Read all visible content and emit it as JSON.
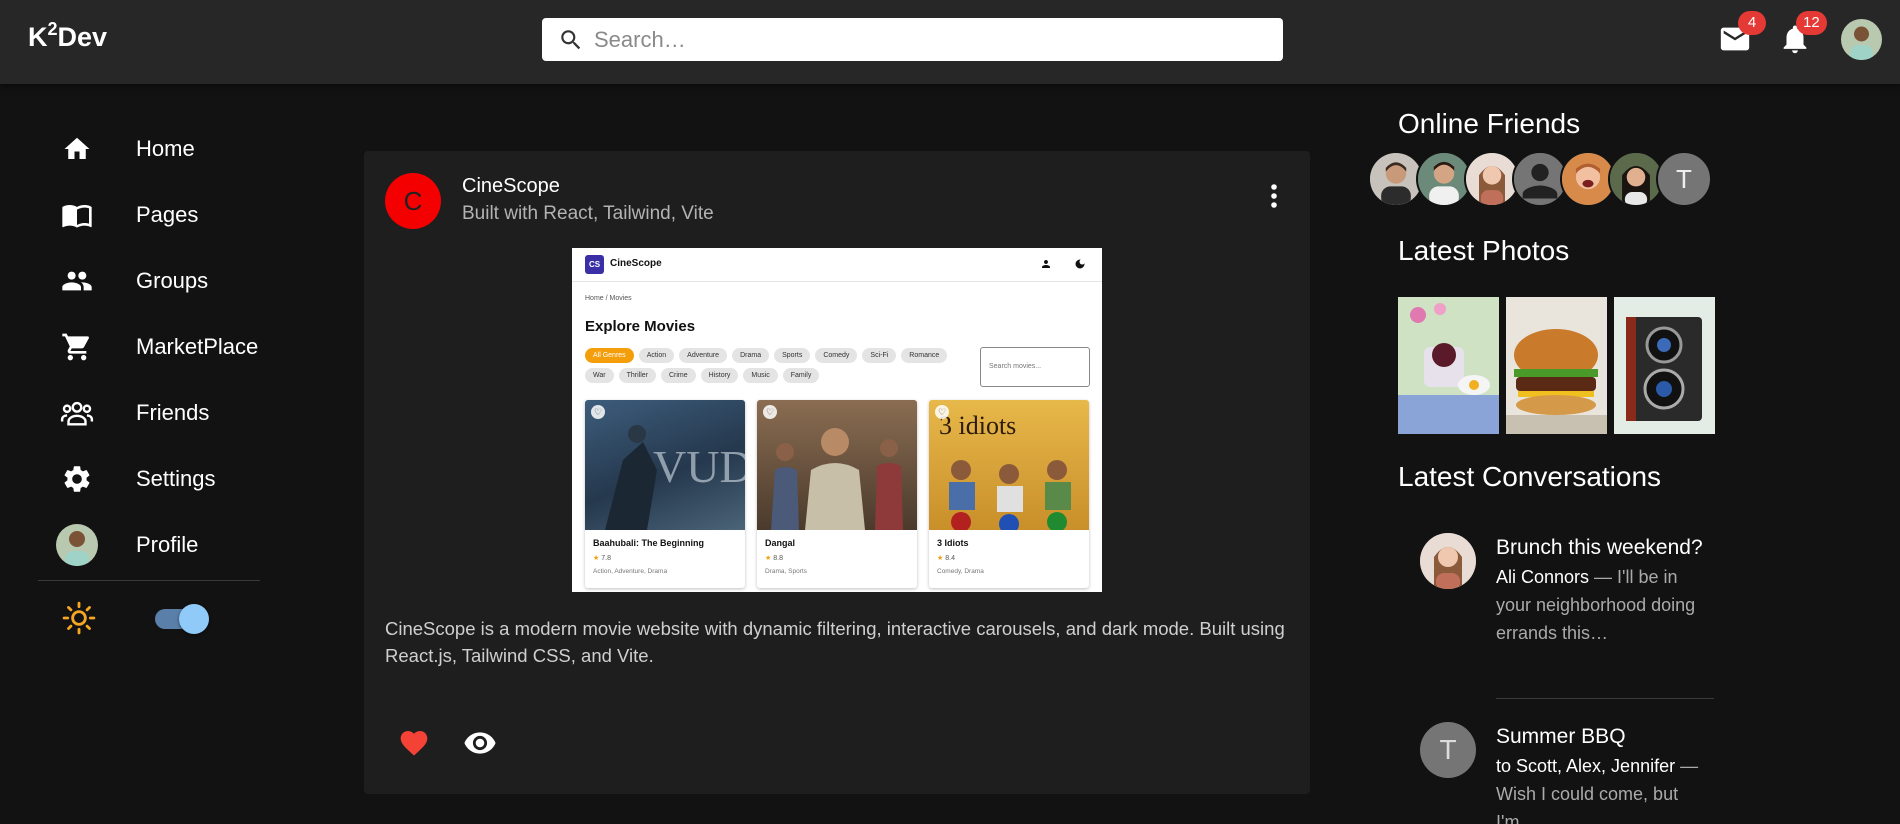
{
  "app": {
    "brand": "K",
    "brand_sup": "2",
    "brand_tail": "Dev"
  },
  "search": {
    "placeholder": "Search…"
  },
  "notifications": {
    "mail_count": "4",
    "bell_count": "12"
  },
  "sidebar": {
    "items": [
      {
        "label": "Home",
        "icon": "home-icon"
      },
      {
        "label": "Pages",
        "icon": "book-icon"
      },
      {
        "label": "Groups",
        "icon": "people-icon"
      },
      {
        "label": "MarketPlace",
        "icon": "cart-icon"
      },
      {
        "label": "Friends",
        "icon": "friends-icon"
      },
      {
        "label": "Settings",
        "icon": "gear-icon"
      },
      {
        "label": "Profile",
        "icon": "avatar"
      }
    ],
    "theme_toggle_on": true
  },
  "post": {
    "avatar_letter": "C",
    "title": "CineScope",
    "subtitle": "Built with React, Tailwind, Vite",
    "description": "CineScope is a modern movie website with dynamic filtering, interactive carousels, and dark mode. Built using React.js, Tailwind CSS, and Vite.",
    "preview": {
      "logo": "CS",
      "brand": "CineScope",
      "breadcrumb": "Home  /  Movies",
      "heading": "Explore Movies",
      "search_placeholder": "Search movies...",
      "genres": [
        "All Genres",
        "Action",
        "Adventure",
        "Drama",
        "Sports",
        "Comedy",
        "Sci-Fi",
        "Romance",
        "War",
        "Thriller",
        "Crime",
        "History",
        "Music",
        "Family"
      ],
      "movies": [
        {
          "title": "Baahubali: The Beginning",
          "rating": "7.8",
          "genres": "Action, Adventure, Drama"
        },
        {
          "title": "Dangal",
          "rating": "8.8",
          "genres": "Drama, Sports"
        },
        {
          "title": "3 Idiots",
          "rating": "8.4",
          "genres": "Comedy, Drama"
        }
      ]
    }
  },
  "right": {
    "online_title": "Online Friends",
    "friends_last_letter": "T",
    "photos_title": "Latest Photos",
    "conversations_title": "Latest Conversations",
    "conversations": [
      {
        "title": "Brunch this weekend?",
        "sender": "Ali Connors",
        "text": " — I'll be in your neighborhood doing errands this…"
      },
      {
        "title": "Summer BBQ",
        "sender": "to Scott, Alex, Jennifer",
        "text": " — Wish I could come, but I'm…",
        "avatar_letter": "T"
      }
    ]
  },
  "colors": {
    "accent": "#90caf9",
    "badge": "#e53935",
    "post_avatar": "#f40000",
    "like": "#f44336"
  }
}
